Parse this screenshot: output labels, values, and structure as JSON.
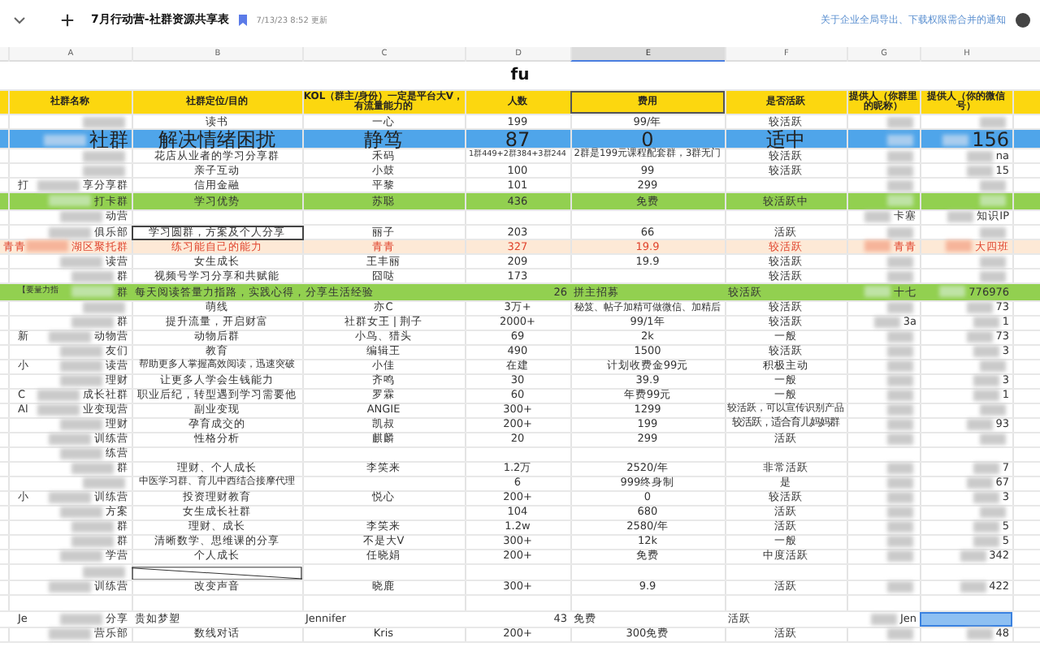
{
  "tab_bar": {
    "title": "7月行动营-社群资源共享表",
    "updated": "7/13/23 8:52 更新",
    "notice_link": "关于企业全局导出、下载权限需合并的通知"
  },
  "columns": [
    {
      "letter": "A",
      "selected": false
    },
    {
      "letter": "B",
      "selected": false
    },
    {
      "letter": "C",
      "selected": false
    },
    {
      "letter": "D",
      "selected": false
    },
    {
      "letter": "E",
      "selected": true
    },
    {
      "letter": "F",
      "selected": false
    },
    {
      "letter": "G",
      "selected": false
    },
    {
      "letter": "H",
      "selected": false
    }
  ],
  "sheet_title": "fu",
  "header": [
    "社群名称",
    "社群定位/目的",
    "KOL（群主/身份）一定是平台大V，有流量能力的",
    "人数",
    "费用",
    "是否活跃",
    "提供人（你群里的昵称）",
    "提供人（你的微信号）"
  ],
  "rows": [
    {
      "kind": "plain",
      "b": "读书",
      "c": "一心",
      "d": "199",
      "e": "99/年",
      "f": "较活跃",
      "blur_a": true,
      "blur_g": true,
      "blur_h": true
    },
    {
      "kind": "blue",
      "a": "社群",
      "b": "解决情绪困扰",
      "c": "静笃",
      "d": "87",
      "e": "0",
      "f": "适中",
      "h": "156",
      "blur_a": true,
      "blur_g": true,
      "blur_h": true
    },
    {
      "kind": "plain",
      "b": "花店从业者的学习分享群",
      "c": "禾码",
      "d": "1群449+2群384+3群244",
      "e": "2群是199元课程配套群，3群无门",
      "f": "较活跃",
      "h": "na",
      "blur_a": true,
      "blur_g": true,
      "blur_h": true
    },
    {
      "kind": "plain",
      "b": "亲子互动",
      "c": "小鼓",
      "d": "100",
      "e": "99",
      "f": "较活跃",
      "h": "15",
      "blur_a": true,
      "blur_g": true,
      "blur_h": true
    },
    {
      "kind": "plain",
      "a_pre": "打",
      "a": "享分享群",
      "b": "信用金融",
      "c": "平黎",
      "d": "101",
      "e": "299",
      "blur_a": true,
      "blur_g": true,
      "blur_h": true
    },
    {
      "kind": "green",
      "a": "打卡群",
      "b": "学习优势",
      "c": "苏聪",
      "d": "436",
      "e": "免费",
      "f": "较活跃中",
      "blur_a": true,
      "blur_g": true,
      "blur_h": true
    },
    {
      "kind": "plain",
      "a": "动营",
      "g": "卡塞",
      "h": "知识IP",
      "blur_a": true,
      "blur_g": true,
      "blur_h": true
    },
    {
      "kind": "plain",
      "a": "俱乐部",
      "b": "学习圆群，方案及个人分享",
      "c": "丽子",
      "d": "203",
      "e": "66",
      "f": "活跃",
      "boxed_b": true,
      "blur_a": true,
      "blur_g": true,
      "blur_h": true
    },
    {
      "kind": "orange",
      "a_pre": "青青",
      "a": "湖区聚托群",
      "b": "练习能自己的能力",
      "c": "青青",
      "d": "327",
      "e": "19.9",
      "f": "较活跃",
      "g": "青青",
      "h": "大四班",
      "blur_a": true,
      "blur_g": true,
      "blur_h": true
    },
    {
      "kind": "plain",
      "a": "读营",
      "b": "女生成长",
      "c": "王丰丽",
      "d": "209",
      "e": "19.9",
      "f": "较活跃",
      "blur_a": true,
      "blur_g": true,
      "blur_h": true
    },
    {
      "kind": "plain",
      "a": "群",
      "b": "视频号学习分享和共赋能",
      "c": "囧哒",
      "d": "173",
      "f": "较活跃",
      "blur_a": true,
      "blur_g": true,
      "blur_h": true
    },
    {
      "kind": "green-raw",
      "a_pre": "【要量力指",
      "a": "群",
      "b": "每天阅读答量力指路，实践心得，分享生活经验",
      "d": "26",
      "e": "拼主招募",
      "f": "较活跃",
      "g": "十七",
      "h": "776976",
      "blur_a": true,
      "blur_g": true,
      "blur_h": true
    },
    {
      "kind": "plain",
      "b": "萌线",
      "c": "亦C",
      "d": "3万+",
      "e": "秘笈、帖子加精可做微信、加精后",
      "f": "较活跃",
      "h": "73",
      "blur_a": true,
      "blur_g": true,
      "blur_h": true
    },
    {
      "kind": "plain",
      "a": "群",
      "b": "提升流量，开启财富",
      "c": "社群女王 | 荆子",
      "d": "2000+",
      "e": "99/1年",
      "f": "较活跃",
      "g": "3a",
      "h": "1",
      "blur_a": true,
      "blur_g": true,
      "blur_h": true
    },
    {
      "kind": "plain",
      "a_pre": "新",
      "a": "动物营",
      "b": "动物后群",
      "c": "小鸟、猎头",
      "d": "69",
      "e": "2k",
      "f": "一般",
      "h": "73",
      "blur_a": true,
      "blur_g": true,
      "blur_h": true
    },
    {
      "kind": "plain",
      "a": "友们",
      "b": "教育",
      "c": "编辑王",
      "d": "490",
      "e": "1500",
      "f": "较活跃",
      "h": "3",
      "blur_a": true,
      "blur_g": true,
      "blur_h": true
    },
    {
      "kind": "plain",
      "a_pre": "小",
      "a": "读营",
      "b": "帮助更多人掌握高效阅读，迅速突破",
      "c": "小佳",
      "d": "在建",
      "e": "计划收费金99元",
      "f": "积极主动",
      "blur_a": true,
      "blur_g": true,
      "blur_h": true
    },
    {
      "kind": "plain",
      "a": "理财",
      "b": "让更多人学会生钱能力",
      "c": "齐鸣",
      "d": "30",
      "e": "39.9",
      "f": "一般",
      "h": "3",
      "blur_a": true,
      "blur_g": true,
      "blur_h": true
    },
    {
      "kind": "plain",
      "a_pre": "C",
      "a": "成长社群",
      "b": "职业后纪，转型遇到学习需要他",
      "c": "罗霖",
      "d": "60",
      "e": "年费99元",
      "f": "一般",
      "h": "1",
      "blur_a": true,
      "blur_g": true,
      "blur_h": true
    },
    {
      "kind": "plain",
      "a_pre": "Al",
      "a": "业变现营",
      "b": "副业变现",
      "c": "ANGIE",
      "d": "300+",
      "e": "1299",
      "f": "较活跃，可以宣传识别产品",
      "blur_a": true,
      "blur_g": true,
      "blur_h": true
    },
    {
      "kind": "plain",
      "a": "理财",
      "b": "孕育成交的",
      "c": "凯叔",
      "d": "200+",
      "e": "199",
      "f": "较活跃，适合育儿妈妈群",
      "h": "93",
      "blur_a": true,
      "blur_g": true,
      "blur_h": true
    },
    {
      "kind": "plain",
      "a": "训练营",
      "b": "性格分析",
      "c": "麒麟",
      "d": "20",
      "e": "299",
      "f": "活跃",
      "blur_a": true,
      "blur_g": true,
      "blur_h": true
    },
    {
      "kind": "plain",
      "a": "练营",
      "blur_a": true
    },
    {
      "kind": "plain",
      "a": "群",
      "b": "理财、个人成长",
      "c": "李笑来",
      "d": "1.2万",
      "e": "2520/年",
      "f": "非常活跃",
      "h": "7",
      "blur_a": true,
      "blur_g": true,
      "blur_h": true
    },
    {
      "kind": "plain",
      "b": "中医学习群、育儿中西结合接摩代理",
      "d": "6",
      "e": "999终身制",
      "f": "是",
      "h": "67",
      "blur_a": true,
      "blur_g": true,
      "blur_h": true
    },
    {
      "kind": "plain",
      "a_pre": "小",
      "a": "训练营",
      "b": "投资理财教育",
      "c": "悦心",
      "d": "200+",
      "e": "0",
      "f": "较活跃",
      "h": "3",
      "blur_a": true,
      "blur_g": true,
      "blur_h": true
    },
    {
      "kind": "plain",
      "a": "方案",
      "b": "女生成长社群",
      "d": "104",
      "e": "680",
      "f": "活跃",
      "blur_a": true,
      "blur_g": true,
      "blur_h": true
    },
    {
      "kind": "plain",
      "a": "群",
      "b": "理财、成长",
      "c": "李笑来",
      "d": "1.2w",
      "e": "2580/年",
      "f": "活跃",
      "h": "5",
      "blur_a": true,
      "blur_g": true,
      "blur_h": true
    },
    {
      "kind": "plain",
      "a": "群",
      "b": "清晰数学、思维课的分享",
      "c": "不是大V",
      "d": "300+",
      "e": "12k",
      "f": "一般",
      "h": "5",
      "blur_a": true,
      "blur_g": true,
      "blur_h": true
    },
    {
      "kind": "plain",
      "a": "学营",
      "b": "个人成长",
      "c": "任晓娟",
      "d": "200+",
      "e": "免费",
      "f": "中度活跃",
      "h": "342",
      "blur_a": true,
      "blur_g": true,
      "blur_h": true
    },
    {
      "kind": "diagonal",
      "blur_a": true
    },
    {
      "kind": "plain",
      "a": "训练营",
      "b": "改变声音",
      "c": "晓鹿",
      "d": "300+",
      "e": "9.9",
      "f": "活跃",
      "h": "422",
      "blur_a": true,
      "blur_g": true,
      "blur_h": true
    },
    {
      "kind": "empty"
    },
    {
      "kind": "raw",
      "a_pre": "Je",
      "a": "分享",
      "b": "贵如梦塑",
      "c": "Jennifer",
      "d": "43",
      "e": "免费",
      "f": "活跃",
      "g": "Jen",
      "highlight_h": true,
      "blur_a": true,
      "blur_g": true
    },
    {
      "kind": "plain",
      "a": "营乐部",
      "b": "数线对话",
      "c": "Kris",
      "d": "200+",
      "e": "300免费",
      "f": "活跃",
      "h": "48",
      "blur_a": true,
      "blur_g": true,
      "blur_h": true
    }
  ]
}
